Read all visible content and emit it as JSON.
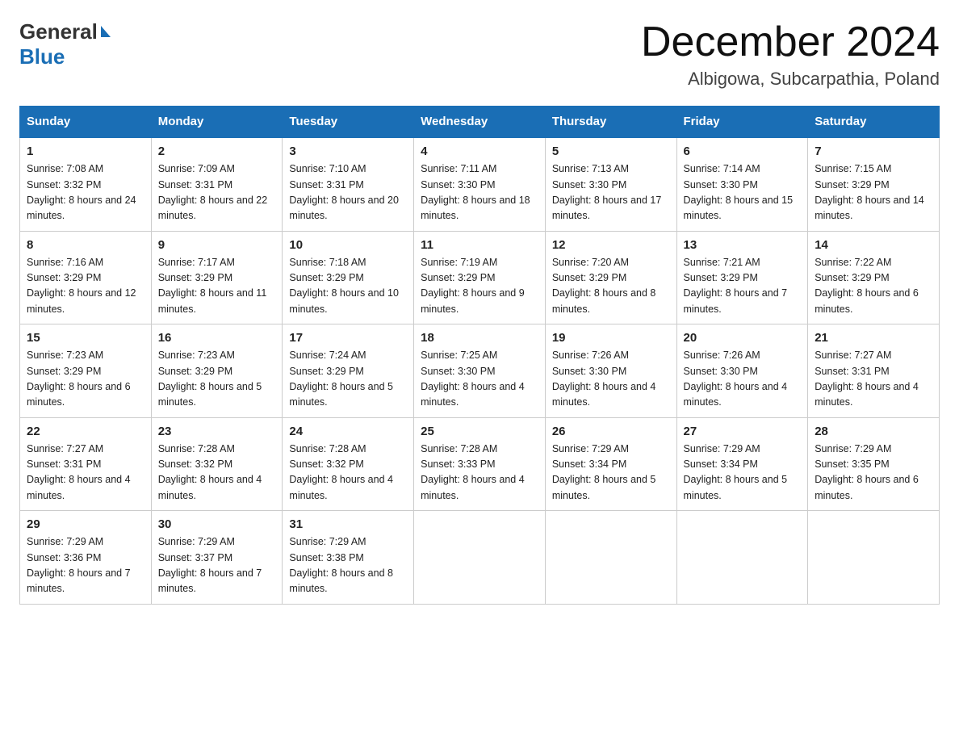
{
  "header": {
    "month_title": "December 2024",
    "location": "Albigowa, Subcarpathia, Poland",
    "logo_general": "General",
    "logo_blue": "Blue"
  },
  "days_of_week": [
    "Sunday",
    "Monday",
    "Tuesday",
    "Wednesday",
    "Thursday",
    "Friday",
    "Saturday"
  ],
  "weeks": [
    [
      {
        "day": "1",
        "sunrise": "7:08 AM",
        "sunset": "3:32 PM",
        "daylight": "8 hours and 24 minutes."
      },
      {
        "day": "2",
        "sunrise": "7:09 AM",
        "sunset": "3:31 PM",
        "daylight": "8 hours and 22 minutes."
      },
      {
        "day": "3",
        "sunrise": "7:10 AM",
        "sunset": "3:31 PM",
        "daylight": "8 hours and 20 minutes."
      },
      {
        "day": "4",
        "sunrise": "7:11 AM",
        "sunset": "3:30 PM",
        "daylight": "8 hours and 18 minutes."
      },
      {
        "day": "5",
        "sunrise": "7:13 AM",
        "sunset": "3:30 PM",
        "daylight": "8 hours and 17 minutes."
      },
      {
        "day": "6",
        "sunrise": "7:14 AM",
        "sunset": "3:30 PM",
        "daylight": "8 hours and 15 minutes."
      },
      {
        "day": "7",
        "sunrise": "7:15 AM",
        "sunset": "3:29 PM",
        "daylight": "8 hours and 14 minutes."
      }
    ],
    [
      {
        "day": "8",
        "sunrise": "7:16 AM",
        "sunset": "3:29 PM",
        "daylight": "8 hours and 12 minutes."
      },
      {
        "day": "9",
        "sunrise": "7:17 AM",
        "sunset": "3:29 PM",
        "daylight": "8 hours and 11 minutes."
      },
      {
        "day": "10",
        "sunrise": "7:18 AM",
        "sunset": "3:29 PM",
        "daylight": "8 hours and 10 minutes."
      },
      {
        "day": "11",
        "sunrise": "7:19 AM",
        "sunset": "3:29 PM",
        "daylight": "8 hours and 9 minutes."
      },
      {
        "day": "12",
        "sunrise": "7:20 AM",
        "sunset": "3:29 PM",
        "daylight": "8 hours and 8 minutes."
      },
      {
        "day": "13",
        "sunrise": "7:21 AM",
        "sunset": "3:29 PM",
        "daylight": "8 hours and 7 minutes."
      },
      {
        "day": "14",
        "sunrise": "7:22 AM",
        "sunset": "3:29 PM",
        "daylight": "8 hours and 6 minutes."
      }
    ],
    [
      {
        "day": "15",
        "sunrise": "7:23 AM",
        "sunset": "3:29 PM",
        "daylight": "8 hours and 6 minutes."
      },
      {
        "day": "16",
        "sunrise": "7:23 AM",
        "sunset": "3:29 PM",
        "daylight": "8 hours and 5 minutes."
      },
      {
        "day": "17",
        "sunrise": "7:24 AM",
        "sunset": "3:29 PM",
        "daylight": "8 hours and 5 minutes."
      },
      {
        "day": "18",
        "sunrise": "7:25 AM",
        "sunset": "3:30 PM",
        "daylight": "8 hours and 4 minutes."
      },
      {
        "day": "19",
        "sunrise": "7:26 AM",
        "sunset": "3:30 PM",
        "daylight": "8 hours and 4 minutes."
      },
      {
        "day": "20",
        "sunrise": "7:26 AM",
        "sunset": "3:30 PM",
        "daylight": "8 hours and 4 minutes."
      },
      {
        "day": "21",
        "sunrise": "7:27 AM",
        "sunset": "3:31 PM",
        "daylight": "8 hours and 4 minutes."
      }
    ],
    [
      {
        "day": "22",
        "sunrise": "7:27 AM",
        "sunset": "3:31 PM",
        "daylight": "8 hours and 4 minutes."
      },
      {
        "day": "23",
        "sunrise": "7:28 AM",
        "sunset": "3:32 PM",
        "daylight": "8 hours and 4 minutes."
      },
      {
        "day": "24",
        "sunrise": "7:28 AM",
        "sunset": "3:32 PM",
        "daylight": "8 hours and 4 minutes."
      },
      {
        "day": "25",
        "sunrise": "7:28 AM",
        "sunset": "3:33 PM",
        "daylight": "8 hours and 4 minutes."
      },
      {
        "day": "26",
        "sunrise": "7:29 AM",
        "sunset": "3:34 PM",
        "daylight": "8 hours and 5 minutes."
      },
      {
        "day": "27",
        "sunrise": "7:29 AM",
        "sunset": "3:34 PM",
        "daylight": "8 hours and 5 minutes."
      },
      {
        "day": "28",
        "sunrise": "7:29 AM",
        "sunset": "3:35 PM",
        "daylight": "8 hours and 6 minutes."
      }
    ],
    [
      {
        "day": "29",
        "sunrise": "7:29 AM",
        "sunset": "3:36 PM",
        "daylight": "8 hours and 7 minutes."
      },
      {
        "day": "30",
        "sunrise": "7:29 AM",
        "sunset": "3:37 PM",
        "daylight": "8 hours and 7 minutes."
      },
      {
        "day": "31",
        "sunrise": "7:29 AM",
        "sunset": "3:38 PM",
        "daylight": "8 hours and 8 minutes."
      },
      null,
      null,
      null,
      null
    ]
  ]
}
